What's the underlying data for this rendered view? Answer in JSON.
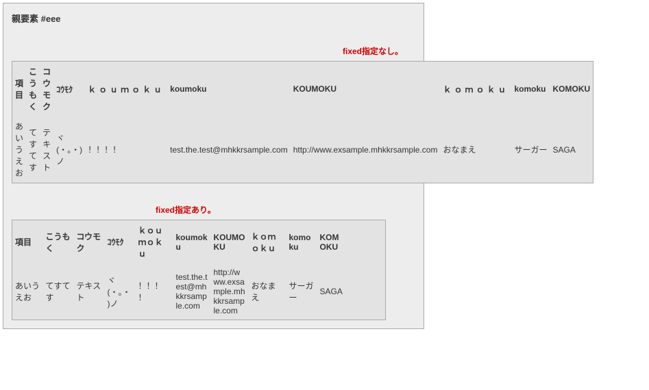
{
  "parent_label": "親要素 #eee",
  "labels": {
    "no_fixed": "fixed指定なし。",
    "with_fixed": "fixed指定あり。"
  },
  "headers": [
    "項目",
    "こうもく",
    "コウモク",
    "ｺｳﾓｸ",
    "ｋｏｕｍｏｋｕ",
    "koumoku",
    "KOUMOKU",
    "ｋｏｍｏｋｕ",
    "komoku",
    "KOMOKU"
  ],
  "row": [
    "あいうえお",
    "てすてす",
    "テキスト",
    "ヾ(・。・)ノ",
    "！！！！",
    "test.the.test@mhkkrsample.com",
    "http://www.exsample.mhkkrsample.com",
    "おなまえ",
    "サーガー",
    "SAGA"
  ]
}
